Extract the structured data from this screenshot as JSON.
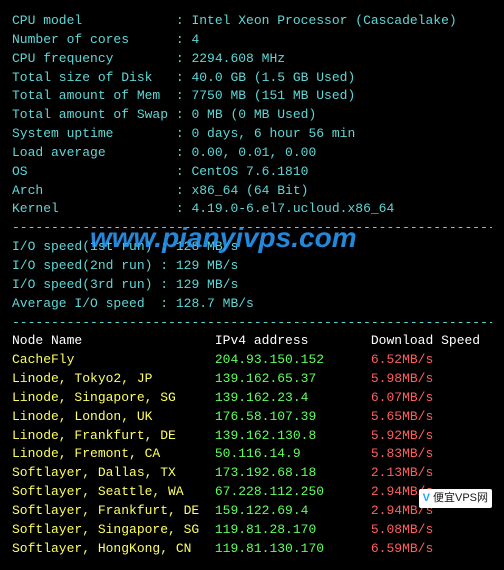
{
  "sysinfo": [
    {
      "label": "CPU model",
      "value": "Intel Xeon Processor (Cascadelake)"
    },
    {
      "label": "Number of cores",
      "value": "4"
    },
    {
      "label": "CPU frequency",
      "value": "2294.608 MHz"
    },
    {
      "label": "Total size of Disk",
      "value": "40.0 GB (1.5 GB Used)"
    },
    {
      "label": "Total amount of Mem",
      "value": "7750 MB (151 MB Used)"
    },
    {
      "label": "Total amount of Swap",
      "value": "0 MB (0 MB Used)"
    },
    {
      "label": "System uptime",
      "value": "0 days, 6 hour 56 min"
    },
    {
      "label": "Load average",
      "value": "0.00, 0.01, 0.00"
    },
    {
      "label": "OS",
      "value": "CentOS 7.6.1810"
    },
    {
      "label": "Arch",
      "value": "x86_64 (64 Bit)"
    },
    {
      "label": "Kernel",
      "value": "4.19.0-6.el7.ucloud.x86_64"
    }
  ],
  "iospeed": [
    {
      "label": "I/O speed(1st run)",
      "value": "128 MB/s"
    },
    {
      "label": "I/O speed(2nd run)",
      "value": "129 MB/s"
    },
    {
      "label": "I/O speed(3rd run)",
      "value": "129 MB/s"
    },
    {
      "label": "Average I/O speed",
      "value": "128.7 MB/s"
    }
  ],
  "node_header": {
    "name": "Node Name",
    "ip": "IPv4 address",
    "speed": "Download Speed"
  },
  "nodes": [
    {
      "name": "CacheFly",
      "ip": "204.93.150.152",
      "speed": "6.52MB/s"
    },
    {
      "name": "Linode, Tokyo2, JP",
      "ip": "139.162.65.37",
      "speed": "5.98MB/s"
    },
    {
      "name": "Linode, Singapore, SG",
      "ip": "139.162.23.4",
      "speed": "6.07MB/s"
    },
    {
      "name": "Linode, London, UK",
      "ip": "176.58.107.39",
      "speed": "5.65MB/s"
    },
    {
      "name": "Linode, Frankfurt, DE",
      "ip": "139.162.130.8",
      "speed": "5.92MB/s"
    },
    {
      "name": "Linode, Fremont, CA",
      "ip": "50.116.14.9",
      "speed": "5.83MB/s"
    },
    {
      "name": "Softlayer, Dallas, TX",
      "ip": "173.192.68.18",
      "speed": "2.13MB/s"
    },
    {
      "name": "Softlayer, Seattle, WA",
      "ip": "67.228.112.250",
      "speed": "2.94MB/s"
    },
    {
      "name": "Softlayer, Frankfurt, DE",
      "ip": "159.122.69.4",
      "speed": "2.94MB/s"
    },
    {
      "name": "Softlayer, Singapore, SG",
      "ip": "119.81.28.170",
      "speed": "5.08MB/s"
    },
    {
      "name": "Softlayer, HongKong, CN",
      "ip": "119.81.130.170",
      "speed": "6.59MB/s"
    }
  ],
  "watermark": "www.pianyivps.com",
  "badge": {
    "prefix": "V",
    "text": "便宜VPS网"
  },
  "divider": "----------------------------------------------------------------------"
}
